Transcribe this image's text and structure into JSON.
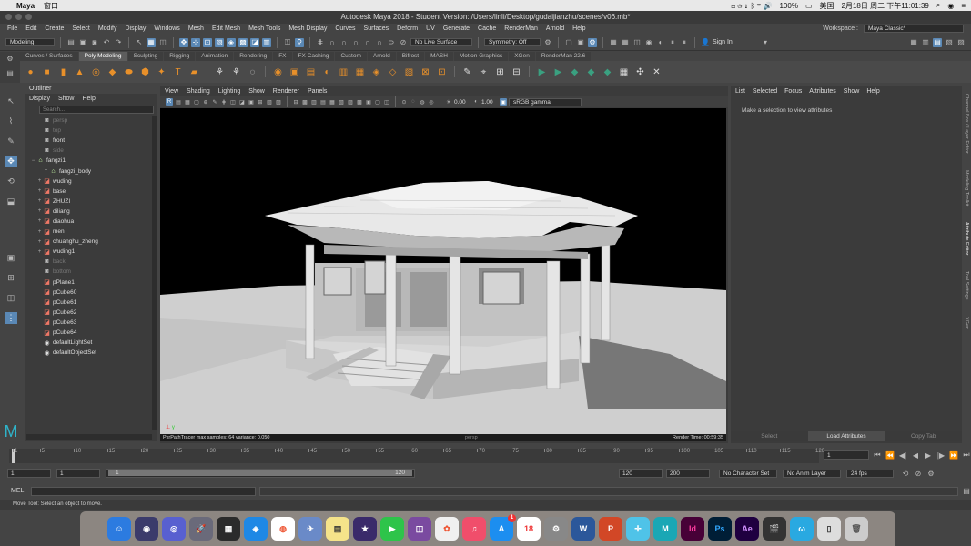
{
  "mac_menubar": {
    "app": "Maya",
    "menus": [
      "窗口"
    ],
    "right_items": [
      "100%",
      "美国",
      "2月18日 周二 下午11:01:39"
    ]
  },
  "window_title": "Autodesk Maya 2018 - Student Version: /Users/linli/Desktop/gudaijianzhu/scenes/v06.mb*",
  "menubar": {
    "items": [
      "File",
      "Edit",
      "Create",
      "Select",
      "Modify",
      "Display",
      "Windows",
      "Mesh",
      "Edit Mesh",
      "Mesh Tools",
      "Mesh Display",
      "Curves",
      "Surfaces",
      "Deform",
      "UV",
      "Generate",
      "Cache",
      "RenderMan",
      "Arnold",
      "Help"
    ],
    "workspace_label": "Workspace :",
    "workspace_value": "Maya Classic*"
  },
  "statusline": {
    "mode": "Modeling",
    "live_surface": "No Live Surface",
    "symmetry": "Symmetry: Off",
    "sign_in": "Sign In"
  },
  "shelf_tabs": [
    "Curves / Surfaces",
    "Poly Modeling",
    "Sculpting",
    "Rigging",
    "Animation",
    "Rendering",
    "FX",
    "FX Caching",
    "Custom",
    "Arnold",
    "Bifrost",
    "MASH",
    "Motion Graphics",
    "XGen",
    "RenderMan 22.6"
  ],
  "shelf_active": "Poly Modeling",
  "outliner": {
    "title": "Outliner",
    "menus": [
      "Display",
      "Show",
      "Help"
    ],
    "search_placeholder": "Search...",
    "items": [
      {
        "label": "persp",
        "icon": "camera-icon",
        "dim": true,
        "indent": 1,
        "expander": ""
      },
      {
        "label": "top",
        "icon": "camera-icon",
        "dim": true,
        "indent": 1,
        "expander": ""
      },
      {
        "label": "front",
        "icon": "camera-icon",
        "dim": false,
        "indent": 1,
        "expander": ""
      },
      {
        "label": "side",
        "icon": "camera-icon",
        "dim": true,
        "indent": 1,
        "expander": ""
      },
      {
        "label": "fangzi1",
        "icon": "group-icon",
        "dim": false,
        "indent": 0,
        "expander": "−"
      },
      {
        "label": "fangzi_body",
        "icon": "group-icon",
        "dim": false,
        "indent": 2,
        "expander": "+"
      },
      {
        "label": "wuding",
        "icon": "mesh-icon",
        "dim": false,
        "indent": 1,
        "expander": "+"
      },
      {
        "label": "base",
        "icon": "mesh-icon",
        "dim": false,
        "indent": 1,
        "expander": "+"
      },
      {
        "label": "ZHUZI",
        "icon": "mesh-icon",
        "dim": false,
        "indent": 1,
        "expander": "+"
      },
      {
        "label": "diliang",
        "icon": "mesh-icon",
        "dim": false,
        "indent": 1,
        "expander": "+"
      },
      {
        "label": "diaohua",
        "icon": "mesh-icon",
        "dim": false,
        "indent": 1,
        "expander": "+"
      },
      {
        "label": "men",
        "icon": "mesh-icon",
        "dim": false,
        "indent": 1,
        "expander": "+"
      },
      {
        "label": "chuanghu_zheng",
        "icon": "mesh-icon",
        "dim": false,
        "indent": 1,
        "expander": "+"
      },
      {
        "label": "wuding1",
        "icon": "mesh-icon",
        "dim": false,
        "indent": 1,
        "expander": "+"
      },
      {
        "label": "back",
        "icon": "camera-icon",
        "dim": true,
        "indent": 1,
        "expander": ""
      },
      {
        "label": "bottom",
        "icon": "camera-icon",
        "dim": true,
        "indent": 1,
        "expander": ""
      },
      {
        "label": "pPlane1",
        "icon": "mesh-icon",
        "dim": false,
        "indent": 1,
        "expander": ""
      },
      {
        "label": "pCube60",
        "icon": "mesh-icon",
        "dim": false,
        "indent": 1,
        "expander": ""
      },
      {
        "label": "pCube61",
        "icon": "mesh-icon",
        "dim": false,
        "indent": 1,
        "expander": ""
      },
      {
        "label": "pCube62",
        "icon": "mesh-icon",
        "dim": false,
        "indent": 1,
        "expander": ""
      },
      {
        "label": "pCube63",
        "icon": "mesh-icon",
        "dim": false,
        "indent": 1,
        "expander": ""
      },
      {
        "label": "pCube64",
        "icon": "mesh-icon",
        "dim": false,
        "indent": 1,
        "expander": ""
      },
      {
        "label": "defaultLightSet",
        "icon": "set-icon",
        "dim": false,
        "indent": 1,
        "expander": ""
      },
      {
        "label": "defaultObjectSet",
        "icon": "set-icon",
        "dim": false,
        "indent": 1,
        "expander": ""
      }
    ]
  },
  "viewport": {
    "menus": [
      "View",
      "Shading",
      "Lighting",
      "Show",
      "Renderer",
      "Panels"
    ],
    "exposure": "0.00",
    "gamma": "1.00",
    "color_space": "sRGB gamma",
    "status_left": "PxrPathTracer  max samples: 64  variance: 0.050",
    "camera": "persp",
    "render_time": "Render Time: 00:59:35"
  },
  "attribute_editor": {
    "menus": [
      "List",
      "Selected",
      "Focus",
      "Attributes",
      "Show",
      "Help"
    ],
    "message": "Make a selection to view attributes",
    "buttons": [
      "Select",
      "Load Attributes",
      "Copy Tab"
    ]
  },
  "side_tabs": [
    "Channel Box / Layer Editor",
    "Modeling Toolkit",
    "Attribute Editor",
    "Tool Settings",
    "XGen"
  ],
  "timeslider": {
    "ticks": [
      1,
      5,
      10,
      15,
      20,
      25,
      30,
      35,
      40,
      45,
      50,
      55,
      60,
      65,
      70,
      75,
      80,
      85,
      90,
      95,
      100,
      105,
      110,
      115,
      120
    ],
    "current_frame": "1"
  },
  "range": {
    "start": "1",
    "playback_start": "1",
    "slider_start": "1",
    "slider_end": "120",
    "playback_end": "120",
    "end": "200",
    "character_set": "No Character Set",
    "anim_layer": "No Anim Layer",
    "fps": "24 fps"
  },
  "cmdline": {
    "label": "MEL"
  },
  "helpline": "Move Tool: Select an object to move.",
  "dock_badge": "1"
}
